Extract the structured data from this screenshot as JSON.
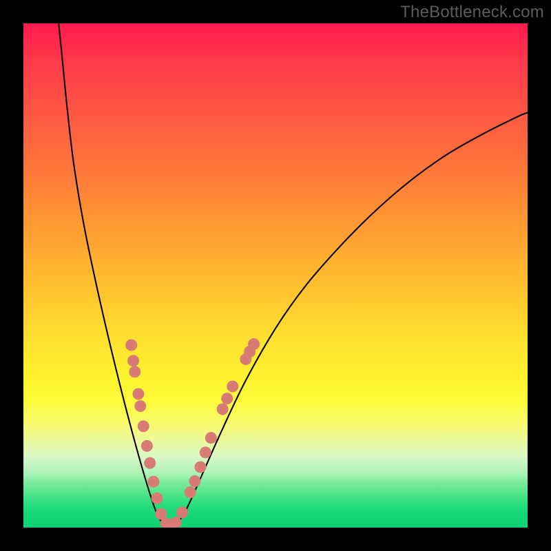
{
  "watermark": "TheBottleneck.com",
  "chart_data": {
    "type": "line",
    "title": "",
    "xlabel": "",
    "ylabel": "",
    "xlim": [
      0,
      1
    ],
    "ylim": [
      0,
      1
    ],
    "background_gradient": {
      "stops": [
        {
          "pos": 0.0,
          "color": "#ff1a4f"
        },
        {
          "pos": 0.4,
          "color": "#ff9a33"
        },
        {
          "pos": 0.7,
          "color": "#fff22e"
        },
        {
          "pos": 0.85,
          "color": "#d7f7c5"
        },
        {
          "pos": 1.0,
          "color": "#0fd172"
        }
      ]
    },
    "series": [
      {
        "name": "bottleneck-curve",
        "type": "line",
        "color": "#000000",
        "points": [
          {
            "x": 0.07,
            "y": 1.0
          },
          {
            "x": 0.078,
            "y": 0.92
          },
          {
            "x": 0.087,
            "y": 0.83
          },
          {
            "x": 0.1,
            "y": 0.72
          },
          {
            "x": 0.12,
            "y": 0.6
          },
          {
            "x": 0.145,
            "y": 0.48
          },
          {
            "x": 0.175,
            "y": 0.35
          },
          {
            "x": 0.205,
            "y": 0.23
          },
          {
            "x": 0.235,
            "y": 0.12
          },
          {
            "x": 0.26,
            "y": 0.04
          },
          {
            "x": 0.275,
            "y": 0.01
          },
          {
            "x": 0.287,
            "y": 0.0
          },
          {
            "x": 0.3,
            "y": 0.005
          },
          {
            "x": 0.32,
            "y": 0.03
          },
          {
            "x": 0.35,
            "y": 0.095
          },
          {
            "x": 0.39,
            "y": 0.185
          },
          {
            "x": 0.44,
            "y": 0.29
          },
          {
            "x": 0.5,
            "y": 0.395
          },
          {
            "x": 0.56,
            "y": 0.48
          },
          {
            "x": 0.63,
            "y": 0.56
          },
          {
            "x": 0.7,
            "y": 0.63
          },
          {
            "x": 0.77,
            "y": 0.69
          },
          {
            "x": 0.84,
            "y": 0.74
          },
          {
            "x": 0.91,
            "y": 0.78
          },
          {
            "x": 0.98,
            "y": 0.815
          },
          {
            "x": 1.0,
            "y": 0.823
          }
        ]
      },
      {
        "name": "marker-dots",
        "type": "scatter",
        "color": "#d87b74",
        "points": [
          {
            "x": 0.214,
            "y": 0.362
          },
          {
            "x": 0.218,
            "y": 0.331
          },
          {
            "x": 0.221,
            "y": 0.309
          },
          {
            "x": 0.228,
            "y": 0.265
          },
          {
            "x": 0.232,
            "y": 0.241
          },
          {
            "x": 0.238,
            "y": 0.201
          },
          {
            "x": 0.245,
            "y": 0.162
          },
          {
            "x": 0.251,
            "y": 0.128
          },
          {
            "x": 0.258,
            "y": 0.091
          },
          {
            "x": 0.265,
            "y": 0.058
          },
          {
            "x": 0.273,
            "y": 0.027
          },
          {
            "x": 0.283,
            "y": 0.008
          },
          {
            "x": 0.292,
            "y": 0.003
          },
          {
            "x": 0.302,
            "y": 0.01
          },
          {
            "x": 0.315,
            "y": 0.03
          },
          {
            "x": 0.331,
            "y": 0.07
          },
          {
            "x": 0.34,
            "y": 0.092
          },
          {
            "x": 0.351,
            "y": 0.12
          },
          {
            "x": 0.361,
            "y": 0.149
          },
          {
            "x": 0.372,
            "y": 0.178
          },
          {
            "x": 0.395,
            "y": 0.235
          },
          {
            "x": 0.404,
            "y": 0.256
          },
          {
            "x": 0.415,
            "y": 0.28
          },
          {
            "x": 0.441,
            "y": 0.334
          },
          {
            "x": 0.449,
            "y": 0.349
          },
          {
            "x": 0.457,
            "y": 0.364
          }
        ]
      }
    ]
  }
}
